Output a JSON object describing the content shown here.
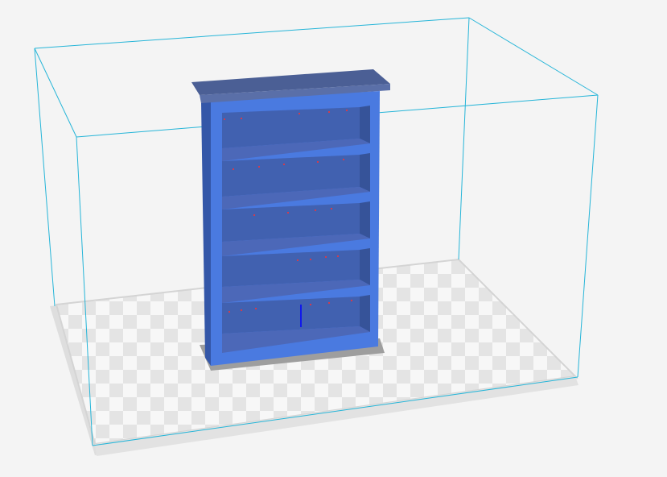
{
  "viewport": {
    "background_color": "#f4f4f4",
    "build_volume_color": "#26b5d8",
    "plate_light_color": "#f7f7f7",
    "plate_dark_color": "#e3e3e3",
    "plate_border_color": "#d6d6d6",
    "model_color": "#4a7ae0",
    "model_shade_color": "#3b64bf",
    "model_top_color": "#4a5f94",
    "model_inner_color": "#4262b3",
    "shadow_color": "#9e9e9e",
    "pin_color": "#ff2020",
    "axis_color": "#0000ff"
  },
  "model": {
    "name": "bookshelf",
    "shelf_count": 5
  }
}
